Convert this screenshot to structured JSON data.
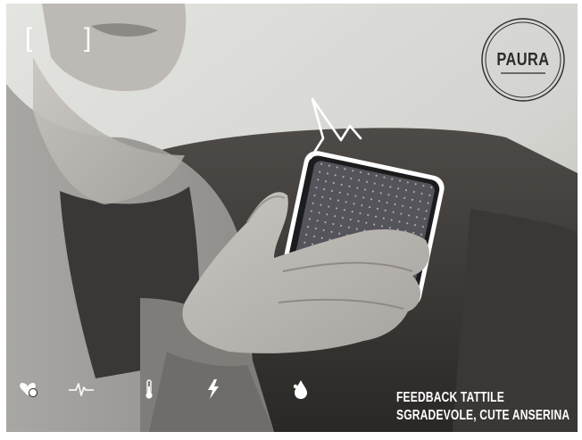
{
  "viewfinder": {
    "left_bracket": "[",
    "right_bracket": "]"
  },
  "emotion": {
    "label": "PAURA"
  },
  "sensors": [
    {
      "icon": "heart-pulse-icon"
    },
    {
      "icon": "heartbeat-line-icon"
    },
    {
      "icon": "thermometer-icon"
    },
    {
      "icon": "lightning-icon"
    },
    {
      "icon": "drop-icon"
    }
  ],
  "caption": {
    "line1": "FEEDBACK TATTILE",
    "line2": "SGRADEVOLE, CUTE ANSERINA"
  },
  "colors": {
    "overlay_text": "#ffffff",
    "badge_ink": "#2b2b2b"
  }
}
